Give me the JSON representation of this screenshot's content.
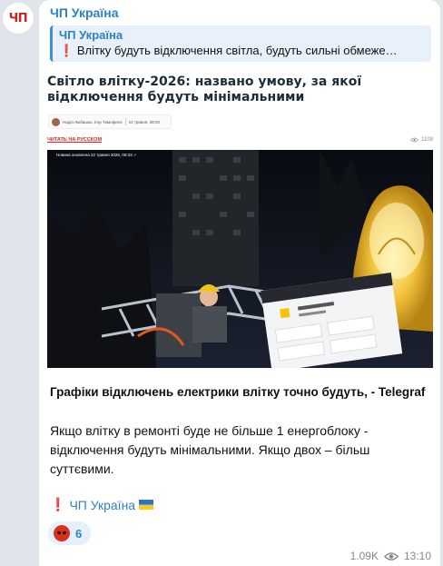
{
  "channel": {
    "avatar_text": "ЧП",
    "name": "ЧП Україна"
  },
  "reply": {
    "title": "ЧП Україна",
    "text": "Влітку будуть відключення світла, будуть сильні обмеже…"
  },
  "preview": {
    "article_title": "Світло влітку-2026: названо умову, за якої відключення будуть мінімальними",
    "byline_authors": "Надія Любашко, Ігор Тимофеєв",
    "byline_date": "22 травня, 08:00",
    "read_in_russian": "ЧИТАТЬ НА РУССКОМ",
    "article_views": "1109",
    "photo_caption": "Новина оновлена 22 травня 2026, 08:33"
  },
  "message": {
    "headline": "Графіки відключень електрики влітку точно будуть, - Telegraf",
    "body": "Якщо влітку в ремонті буде не більше 1 енергоблоку - відключення будуть мінімальними. Якщо двох – більш суттєвими.",
    "footer": "ЧП Україна"
  },
  "reaction": {
    "emoji": "angry-face",
    "count": "6"
  },
  "meta": {
    "views": "1.09K",
    "time": "13:10"
  },
  "colors": {
    "accent": "#2b82c3",
    "alert": "#e0241f",
    "background": "#dfe5ea"
  }
}
